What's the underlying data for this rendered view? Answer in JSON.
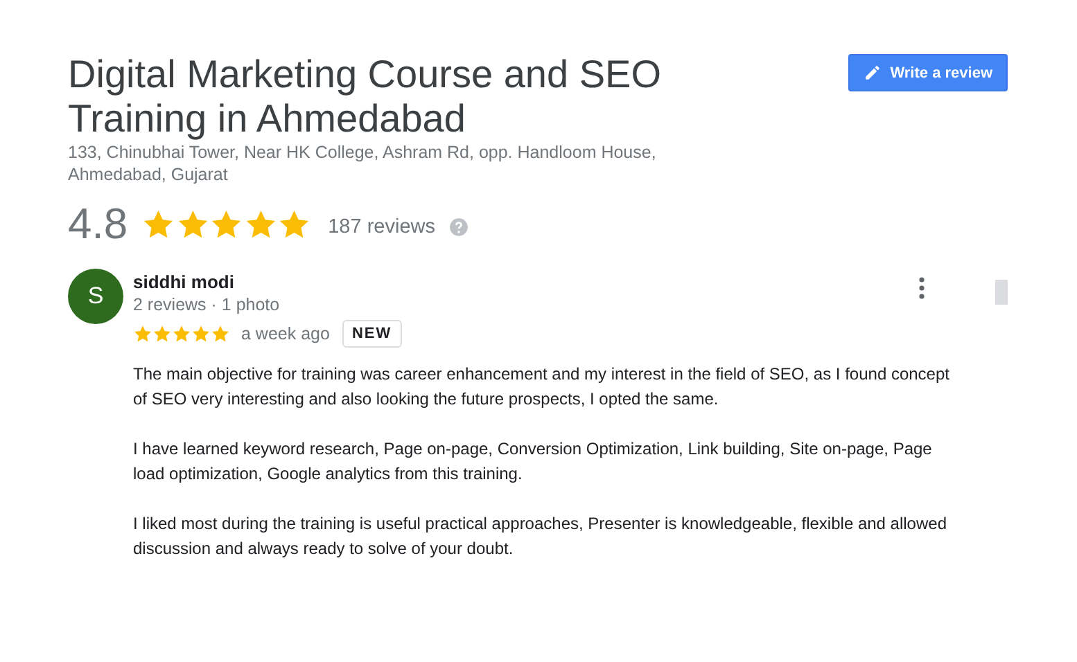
{
  "place": {
    "title": "Digital Marketing Course and SEO Training in Ahmedabad",
    "address": "133, Chinubhai Tower, Near HK College, Ashram Rd, opp. Handloom House, Ahmedabad, Gujarat",
    "write_review_button": "Write a review"
  },
  "rating": {
    "score": "4.8",
    "stars": 5,
    "count": "187 reviews"
  },
  "review": {
    "avatar_letter": "S",
    "author": "siddhi modi",
    "meta": "2 reviews · 1 photo",
    "stars": 5,
    "time": "a week ago",
    "badge": "NEW",
    "paragraphs": [
      "The main objective for training was career enhancement and my interest in the field of SEO, as I found concept of SEO very interesting and also looking the future prospects, I opted the same.",
      "I have learned keyword research, Page on-page, Conversion Optimization, Link building, Site on-page, Page load optimization, Google analytics from this training.",
      "I liked most during the training is useful practical approaches, Presenter is knowledgeable, flexible and allowed discussion and always ready to solve of your doubt."
    ]
  }
}
